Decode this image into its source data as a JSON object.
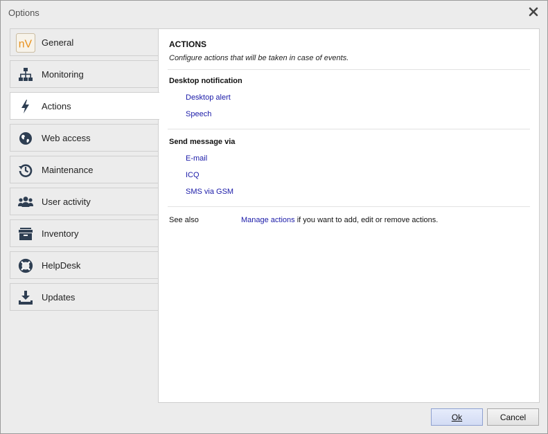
{
  "window": {
    "title": "Options"
  },
  "sidebar": {
    "items": [
      {
        "label": "General",
        "icon": "nv-logo-icon"
      },
      {
        "label": "Monitoring",
        "icon": "network-icon"
      },
      {
        "label": "Actions",
        "icon": "lightning-icon",
        "active": true
      },
      {
        "label": "Web access",
        "icon": "globe-icon"
      },
      {
        "label": "Maintenance",
        "icon": "history-icon"
      },
      {
        "label": "User activity",
        "icon": "users-icon"
      },
      {
        "label": "Inventory",
        "icon": "archive-box-icon"
      },
      {
        "label": "HelpDesk",
        "icon": "lifebuoy-icon"
      },
      {
        "label": "Updates",
        "icon": "download-icon"
      }
    ],
    "logo_text": "nV"
  },
  "content": {
    "title": "ACTIONS",
    "description": "Configure actions that will be taken in case of events.",
    "sections": [
      {
        "title": "Desktop notification",
        "links": [
          "Desktop alert",
          "Speech"
        ]
      },
      {
        "title": "Send message via",
        "links": [
          "E-mail",
          "ICQ",
          "SMS via GSM"
        ]
      }
    ],
    "see_also": {
      "label": "See also",
      "link": "Manage actions",
      "suffix": " if you want to add, edit or remove actions."
    }
  },
  "buttons": {
    "ok": "Ok",
    "cancel": "Cancel"
  },
  "colors": {
    "link": "#1a1aa8",
    "icon": "#2e3e52",
    "logo_orange": "#e8901c"
  }
}
